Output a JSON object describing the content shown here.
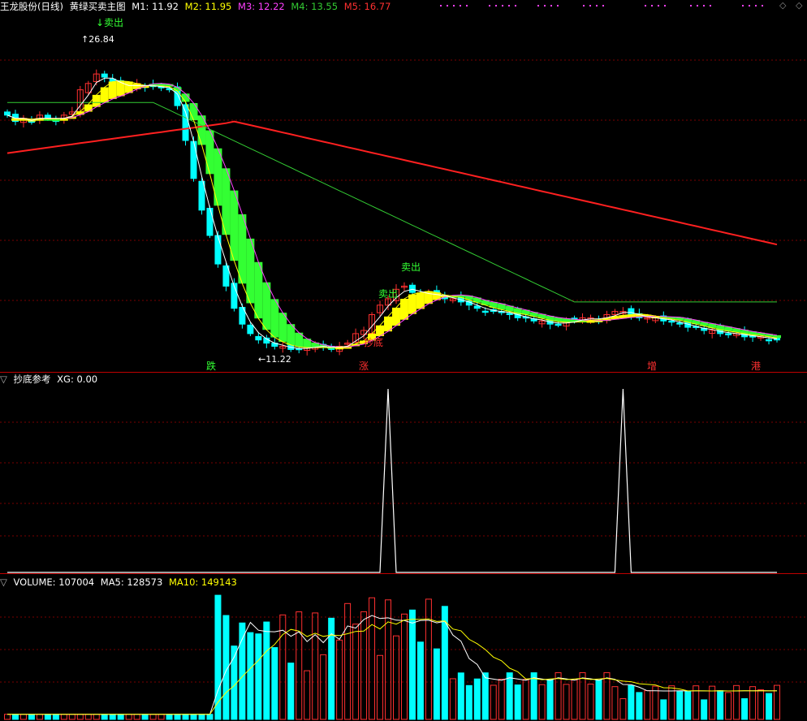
{
  "main_panel": {
    "title": "王龙股份(日线)",
    "indicator": "黄绿买卖主图",
    "ma_items": [
      {
        "label": "M1: 11.92",
        "color": "#ffffff"
      },
      {
        "label": "M2: 11.95",
        "color": "#ffff00"
      },
      {
        "label": "M3: 12.22",
        "color": "#ff40ff"
      },
      {
        "label": "M4: 13.55",
        "color": "#33cc33"
      },
      {
        "label": "M5: 16.77",
        "color": "#ff3030"
      }
    ],
    "annotations": {
      "sell_1": "卖出",
      "sell_2": "卖出",
      "sell_3": "卖出",
      "bottom_buy": "抄底",
      "high_price": "26.84",
      "low_price": "11.22"
    },
    "bottom_markers": [
      {
        "label": "跌",
        "color": "#33ff33"
      },
      {
        "label": "涨",
        "color": "#ff3030"
      },
      {
        "label": "增",
        "color": "#ff3030"
      },
      {
        "label": "港",
        "color": "#ff3030"
      }
    ]
  },
  "sub_panel": {
    "title": "抄底参考",
    "xg_label": "XG: 0.00"
  },
  "volume_panel": {
    "volume_label": "VOLUME: 107004",
    "ma5_label": "MA5: 128573",
    "ma10_label": "MA10: 149143"
  },
  "colors": {
    "up": "#ff3030",
    "down": "#00ffff",
    "yellow_band": "#ffff00",
    "green_band": "#33ff33",
    "grid": "#7a0000"
  },
  "chart_data": [
    {
      "type": "line",
      "panel": "candlestick-main",
      "title": "黄绿买卖主图",
      "series_names": [
        "M1",
        "M2",
        "M3",
        "M4",
        "M5"
      ],
      "latest": {
        "M1": 11.92,
        "M2": 11.95,
        "M3": 12.22,
        "M4": 13.55,
        "M5": 16.77
      },
      "high_label": 26.84,
      "low_label": 11.22,
      "x_count": 96,
      "close_path_fraction": [
        0.22,
        0.24,
        0.23,
        0.24,
        0.22,
        0.23,
        0.24,
        0.22,
        0.21,
        0.14,
        0.12,
        0.09,
        0.1,
        0.12,
        0.13,
        0.13,
        0.12,
        0.13,
        0.13,
        0.13,
        0.14,
        0.19,
        0.3,
        0.42,
        0.52,
        0.6,
        0.69,
        0.76,
        0.83,
        0.88,
        0.91,
        0.93,
        0.94,
        0.95,
        0.95,
        0.96,
        0.96,
        0.95,
        0.95,
        0.95,
        0.96,
        0.95,
        0.94,
        0.91,
        0.9,
        0.85,
        0.82,
        0.8,
        0.77,
        0.76,
        0.78,
        0.79,
        0.78,
        0.79,
        0.8,
        0.8,
        0.81,
        0.82,
        0.83,
        0.84,
        0.84,
        0.84,
        0.85,
        0.86,
        0.86,
        0.87,
        0.87,
        0.88,
        0.88,
        0.87,
        0.87,
        0.86,
        0.86,
        0.87,
        0.85,
        0.84,
        0.84,
        0.85,
        0.86,
        0.86,
        0.86,
        0.87,
        0.87,
        0.88,
        0.89,
        0.89,
        0.9,
        0.9,
        0.91,
        0.91,
        0.91,
        0.92,
        0.92,
        0.92,
        0.93,
        0.93
      ]
    },
    {
      "type": "line",
      "panel": "抄底参考",
      "series_names": [
        "XG"
      ],
      "latest": {
        "XG": 0.0
      },
      "x_count": 96,
      "spikes_at_index": [
        47,
        76
      ],
      "ylim": [
        0,
        1
      ]
    },
    {
      "type": "bar",
      "panel": "volume",
      "series_names": [
        "VOLUME",
        "MA5",
        "MA10"
      ],
      "latest": {
        "VOLUME": 107004,
        "MA5": 128573,
        "MA10": 149143
      }
    }
  ]
}
